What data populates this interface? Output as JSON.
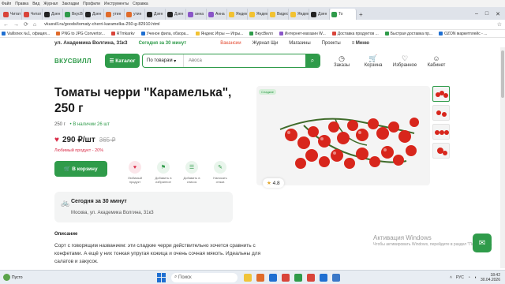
{
  "browser": {
    "menu": [
      "Файл",
      "Правка",
      "Вид",
      "Журнал",
      "Закладки",
      "Профили",
      "Инструменты",
      "Справка"
    ],
    "tabs": [
      {
        "label": "Читат",
        "color": "#d9443a"
      },
      {
        "label": "Читат",
        "color": "#d9443a"
      },
      {
        "label": "Дзен",
        "color": "#222222"
      },
      {
        "label": "ВкусВ",
        "color": "#2f9b4a"
      },
      {
        "label": "Дзен",
        "color": "#222222"
      },
      {
        "label": "утин",
        "color": "#e06b2a"
      },
      {
        "label": "утин",
        "color": "#e06b2a"
      },
      {
        "label": "Дзен",
        "color": "#222222"
      },
      {
        "label": "Дзен",
        "color": "#222222"
      },
      {
        "label": "анна",
        "color": "#8a56c8"
      },
      {
        "label": "Анна",
        "color": "#8a56c8"
      },
      {
        "label": "Яндек",
        "color": "#f2c232"
      },
      {
        "label": "Яндек",
        "color": "#f2c232"
      },
      {
        "label": "Видео",
        "color": "#f2c232"
      },
      {
        "label": "Яндек",
        "color": "#f2c232"
      },
      {
        "label": "Дзен",
        "color": "#222222"
      }
    ],
    "active_tab": "То",
    "url": "vkusvill.ru/goods/tomaty-cherri-karamelka-250-g-82910.html",
    "bookmarks": [
      {
        "label": "Vaillsnex №1, официя...",
        "color": "#1f6fd1"
      },
      {
        "label": "PNG to JPG Convertor...",
        "color": "#e06b2a"
      },
      {
        "label": "RTmkarkv",
        "color": "#d9443a"
      },
      {
        "label": "Ученое фила, обзора...",
        "color": "#1f6fd1"
      },
      {
        "label": "Яндекс Игры — Игры...",
        "color": "#f2c232"
      },
      {
        "label": "ВкусВилл",
        "color": "#2f9b4a"
      },
      {
        "label": "Интернет-магазин W...",
        "color": "#8a56c8"
      },
      {
        "label": "Доставка продуктов ...",
        "color": "#d9443a"
      },
      {
        "label": "Быстрая доставка пр...",
        "color": "#2f9b4a"
      },
      {
        "label": "OZON маркетплейс - ...",
        "color": "#1f6fd1"
      }
    ]
  },
  "site": {
    "address": "ул. Академика Волгина, 31к3",
    "today": "Сегодня за 30 минут",
    "nav": [
      "Вакансии",
      "Журнал Щи",
      "Магазины",
      "Проекты"
    ],
    "menu": "Меню",
    "logo": "ВКУСВИЛЛ",
    "catalog": "Каталог",
    "search_scope": "По товарам",
    "search_placeholder": "Авоса",
    "header_icons": [
      {
        "label": "Заказы",
        "icon": "clock-icon"
      },
      {
        "label": "Корзина",
        "icon": "cart-icon"
      },
      {
        "label": "Избранное",
        "icon": "heart-icon"
      },
      {
        "label": "Кабинет",
        "icon": "user-icon"
      }
    ]
  },
  "product": {
    "title": "Томаты черри \"Карамелька\", 250 г",
    "weight": "250 г",
    "stock": "В наличии 26 шт",
    "price": "290 ₽/шт",
    "old_price": "365 ₽",
    "fav_note": "Любимый продукт - 20%",
    "cart": "В корзину",
    "actions": [
      {
        "label": "Любимый продукт",
        "icon": "heart-icon",
        "pink": true
      },
      {
        "label": "Добавить в избранное",
        "icon": "bookmark-icon",
        "pink": false
      },
      {
        "label": "Добавить в список",
        "icon": "list-icon",
        "pink": false
      },
      {
        "label": "Написать отзыв",
        "icon": "review-icon",
        "pink": false
      }
    ],
    "delivery_title": "Сегодня за 30 минут",
    "delivery_addr": "Москва, ул. Академика Волгина, 31к3",
    "desc_heading": "Описание",
    "description": "Сорт с говорящим названием: эти сладкие черри действительно хочется сравнить с конфетами. А ещё у них тонкая упругая кожица и очень сочная мякоть. Идеальны для салатов и закусок.",
    "badge": "Сладкие",
    "rating": "4.8"
  },
  "system": {
    "watermark_title": "Активация Windows",
    "watermark_text": "Чтобы активировать Windows, перейдите в раздел \"Параметры\".",
    "taskbar_left": "Пусто",
    "search": "Поиск",
    "lang": "РУС",
    "time": "18:42",
    "date": "30.04.2026"
  }
}
